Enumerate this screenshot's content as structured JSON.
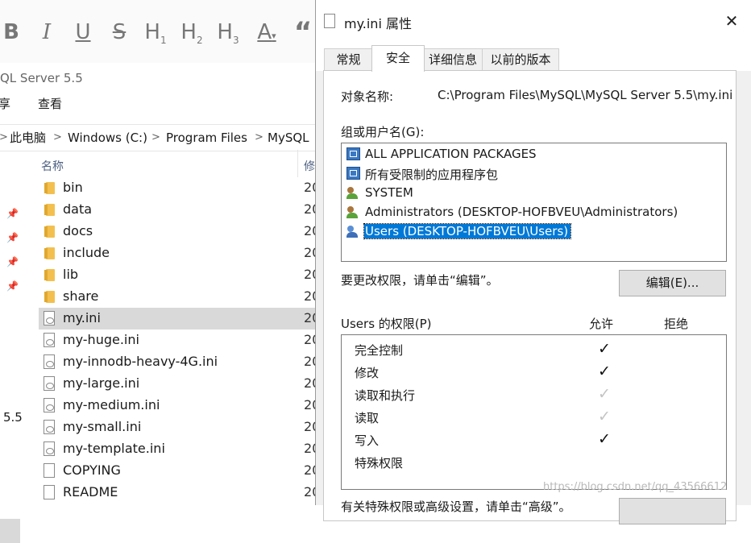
{
  "editor_toolbar": {
    "bold": "B",
    "italic": "I",
    "underline": "U",
    "strike": "S",
    "h1": "H",
    "h1_sub": "1",
    "h2": "H",
    "h2_sub": "2",
    "h3": "H",
    "h3_sub": "3",
    "font_color": "A",
    "quote": "“"
  },
  "explorer": {
    "title": "QL Server 5.5",
    "ribbon": {
      "share": "享",
      "view": "查看"
    },
    "breadcrumb": [
      "此电脑",
      "Windows (C:)",
      "Program Files",
      "MySQL"
    ],
    "breadcrumb_sep": ">",
    "nav_version": "5.5",
    "columns": {
      "name": "名称",
      "modified": "修"
    },
    "files": [
      {
        "name": "bin",
        "type": "folder",
        "date": "20"
      },
      {
        "name": "data",
        "type": "folder",
        "date": "20"
      },
      {
        "name": "docs",
        "type": "folder",
        "date": "20"
      },
      {
        "name": "include",
        "type": "folder",
        "date": "20"
      },
      {
        "name": "lib",
        "type": "folder",
        "date": "20"
      },
      {
        "name": "share",
        "type": "folder",
        "date": "20"
      },
      {
        "name": "my.ini",
        "type": "ini",
        "date": "20",
        "selected": true
      },
      {
        "name": "my-huge.ini",
        "type": "ini",
        "date": "20"
      },
      {
        "name": "my-innodb-heavy-4G.ini",
        "type": "ini",
        "date": "20"
      },
      {
        "name": "my-large.ini",
        "type": "ini",
        "date": "20"
      },
      {
        "name": "my-medium.ini",
        "type": "ini",
        "date": "20"
      },
      {
        "name": "my-small.ini",
        "type": "ini",
        "date": "20"
      },
      {
        "name": "my-template.ini",
        "type": "ini",
        "date": "20"
      },
      {
        "name": "COPYING",
        "type": "doc",
        "date": "20"
      },
      {
        "name": "README",
        "type": "doc",
        "date": "20"
      }
    ]
  },
  "dialog": {
    "title": "my.ini 属性",
    "close": "✕",
    "tabs": [
      {
        "label": "常规",
        "active": false
      },
      {
        "label": "安全",
        "active": true
      },
      {
        "label": "详细信息",
        "active": false
      },
      {
        "label": "以前的版本",
        "active": false
      }
    ],
    "object_name_label": "对象名称:",
    "object_name_value": "C:\\Program Files\\MySQL\\MySQL Server 5.5\\my.ini",
    "groups_label": "组或用户名(G):",
    "users": [
      {
        "label": "ALL APPLICATION PACKAGES",
        "icon": "package-icon"
      },
      {
        "label": "所有受限制的应用程序包",
        "icon": "package-icon"
      },
      {
        "label": "SYSTEM",
        "icon": "users-icon"
      },
      {
        "label": "Administrators (DESKTOP-HOFBVEU\\Administrators)",
        "icon": "users-icon"
      },
      {
        "label": "Users (DESKTOP-HOFBVEU\\Users)",
        "icon": "users-icon",
        "selected": true
      }
    ],
    "change_hint": "要更改权限，请单击“编辑”。",
    "edit_button": "编辑(E)...",
    "permissions_label": "Users 的权限(P)",
    "allow_header": "允许",
    "deny_header": "拒绝",
    "permissions": [
      {
        "name": "完全控制",
        "allow": "dark"
      },
      {
        "name": "修改",
        "allow": "dark"
      },
      {
        "name": "读取和执行",
        "allow": "grey"
      },
      {
        "name": "读取",
        "allow": "grey"
      },
      {
        "name": "写入",
        "allow": "dark"
      },
      {
        "name": "特殊权限",
        "allow": "none"
      }
    ],
    "check_glyph": "✓",
    "bottom_hint": "有关特殊权限或高级设置，请单击“高级”。"
  },
  "watermark": "https://blog.csdn.net/qq_43566612"
}
